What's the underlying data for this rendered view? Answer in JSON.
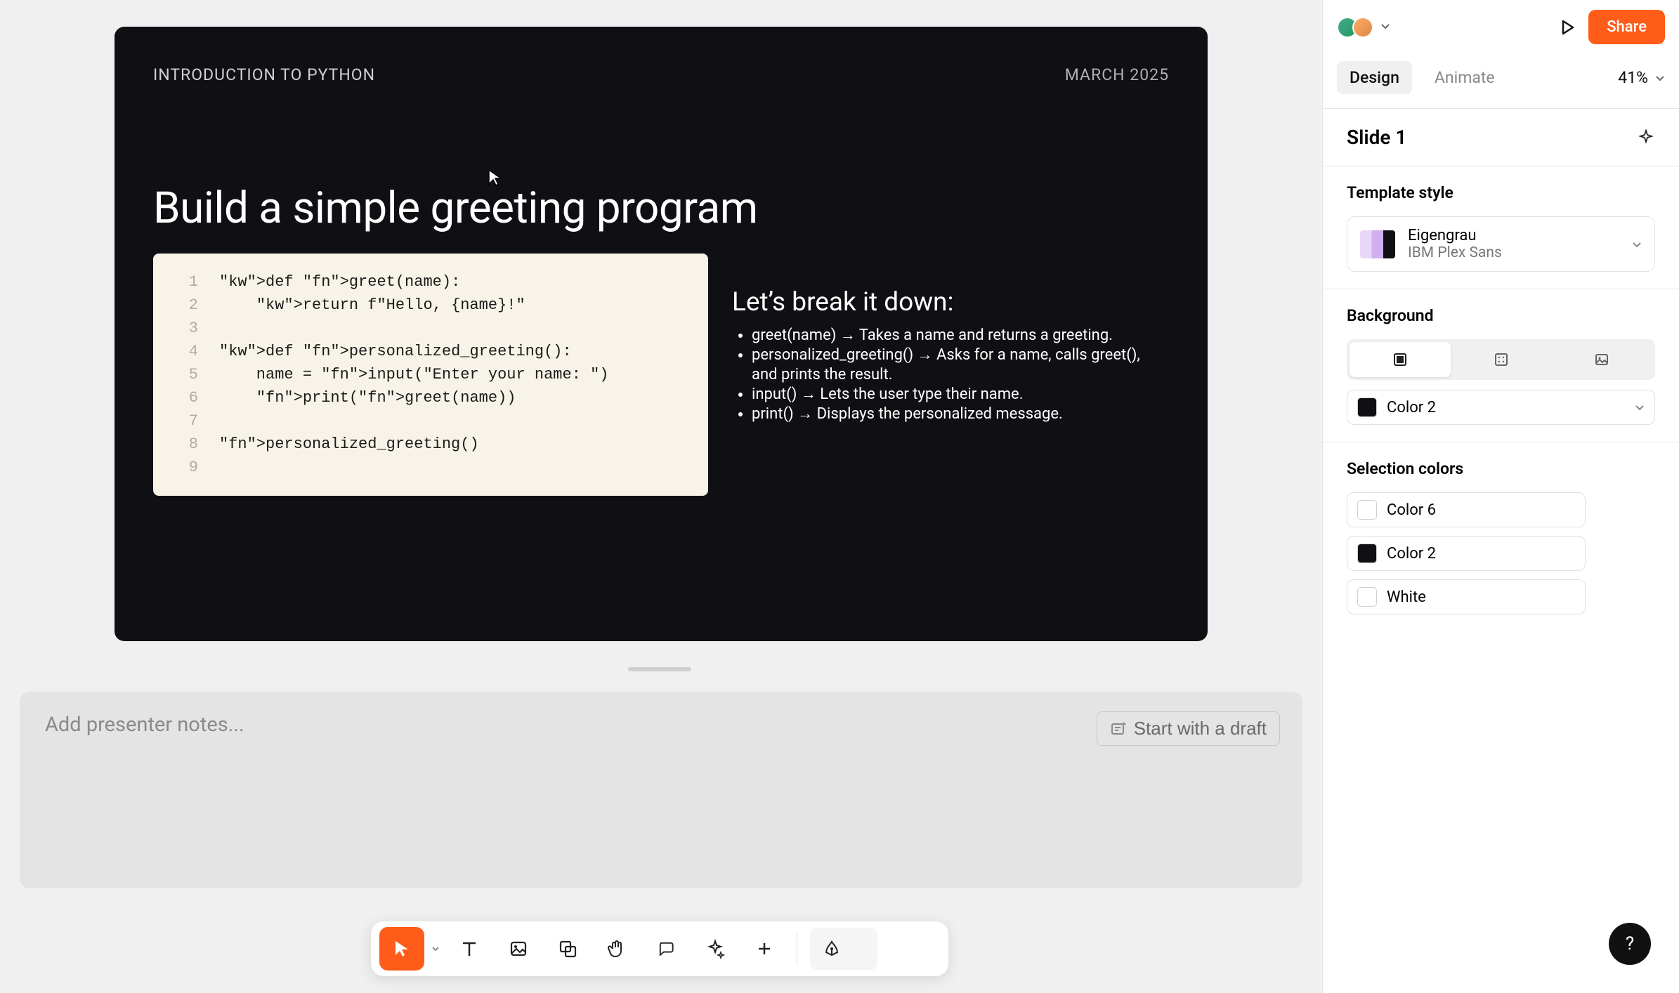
{
  "slide": {
    "kicker": "INTRODUCTION TO PYTHON",
    "date": "MARCH 2025",
    "title": "Build a simple greeting program",
    "code_lines": [
      "def greet(name):",
      "    return f\"Hello, {name}!\"",
      "",
      "def personalized_greeting():",
      "    name = input(\"Enter your name: \")",
      "    print(greet(name))",
      "",
      "personalized_greeting()",
      ""
    ],
    "breakdown_heading": "Let’s break it down:",
    "breakdown_items": [
      "greet(name) → Takes a name and returns a greeting.",
      "personalized_greeting() → Asks for a name, calls greet(), and prints the result.",
      "input() → Lets the user type their name.",
      "print() → Displays the personalized message."
    ]
  },
  "notes": {
    "placeholder": "Add presenter notes...",
    "draft_btn": "Start with a draft"
  },
  "toolbar": {
    "tools": [
      "select",
      "text",
      "image",
      "shape",
      "hand",
      "comment",
      "sparkle",
      "add"
    ],
    "right": [
      "pen"
    ]
  },
  "right": {
    "share": "Share",
    "tabs": {
      "design": "Design",
      "animate": "Animate"
    },
    "zoom": "41%",
    "slide_label": "Slide 1",
    "template_label": "Template style",
    "template": {
      "name": "Eigengrau",
      "font": "IBM Plex Sans"
    },
    "background_label": "Background",
    "background_options": [
      "solid",
      "pattern",
      "image"
    ],
    "background_color": {
      "name": "Color 2",
      "hex": "#101014"
    },
    "selection_label": "Selection colors",
    "selection_colors": [
      {
        "name": "Color 6",
        "hex": "#ffffff"
      },
      {
        "name": "Color 2",
        "hex": "#101014"
      },
      {
        "name": "White",
        "hex": "#ffffff"
      }
    ]
  }
}
